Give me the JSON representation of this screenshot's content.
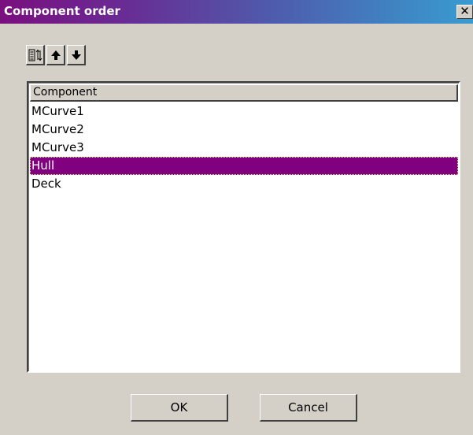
{
  "window": {
    "title": "Component order",
    "close_glyph": "✕"
  },
  "toolbar": {
    "buttons": [
      {
        "name": "sort",
        "icon": "sort-icon"
      },
      {
        "name": "move-up",
        "icon": "arrow-up-icon"
      },
      {
        "name": "move-down",
        "icon": "arrow-down-icon"
      }
    ]
  },
  "list": {
    "column_header": "Component",
    "items": [
      "MCurve1",
      "MCurve2",
      "MCurve3",
      "Hull",
      "Deck"
    ],
    "selected_index": 3,
    "selection_color": "#800080"
  },
  "buttons": {
    "ok_label": "OK",
    "cancel_label": "Cancel"
  },
  "colors": {
    "title_gradient_start": "#7a0f7f",
    "title_gradient_end": "#3a9bd0",
    "face": "#d4d0c8"
  }
}
